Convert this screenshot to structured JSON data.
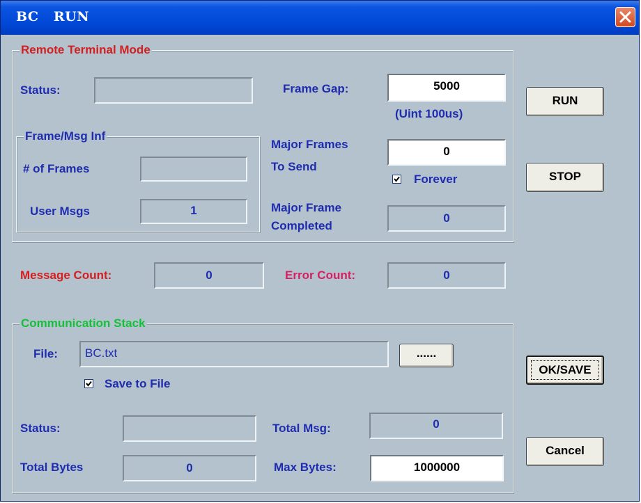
{
  "window": {
    "title": "BC   RUN"
  },
  "remote_terminal": {
    "legend": "Remote Terminal  Mode",
    "status_label": "Status:",
    "status_value": "",
    "frame_gap_label": "Frame Gap:",
    "frame_gap_value": "5000",
    "frame_gap_unit": "(Uint 100us)",
    "frame_msg": {
      "legend": "Frame/Msg Inf",
      "frames_label": "# of Frames",
      "frames_value": "",
      "user_msgs_label": "User Msgs",
      "user_msgs_value": "1"
    },
    "major_frames_label_1": "Major Frames",
    "major_frames_label_2": "To Send",
    "major_frames_value": "0",
    "forever_label": "Forever",
    "forever_checked": true,
    "completed_label_1": "Major Frame",
    "completed_label_2": "Completed",
    "completed_value": "0"
  },
  "counts": {
    "message_count_label": "Message Count:",
    "message_count_value": "0",
    "error_count_label": "Error Count:",
    "error_count_value": "0"
  },
  "comm_stack": {
    "legend": "Communication  Stack",
    "file_label": "File:",
    "file_value": "BC.txt",
    "browse_label": "......",
    "save_to_file_label": "Save to File",
    "save_to_file_checked": true,
    "status_label": "Status:",
    "status_value": "",
    "total_msg_label": "Total Msg:",
    "total_msg_value": "0",
    "total_bytes_label": "Total Bytes",
    "total_bytes_value": "0",
    "max_bytes_label": "Max Bytes:",
    "max_bytes_value": "1000000"
  },
  "buttons": {
    "run": "RUN",
    "stop": "STOP",
    "ok_save": "OK/SAVE",
    "cancel": "Cancel"
  }
}
